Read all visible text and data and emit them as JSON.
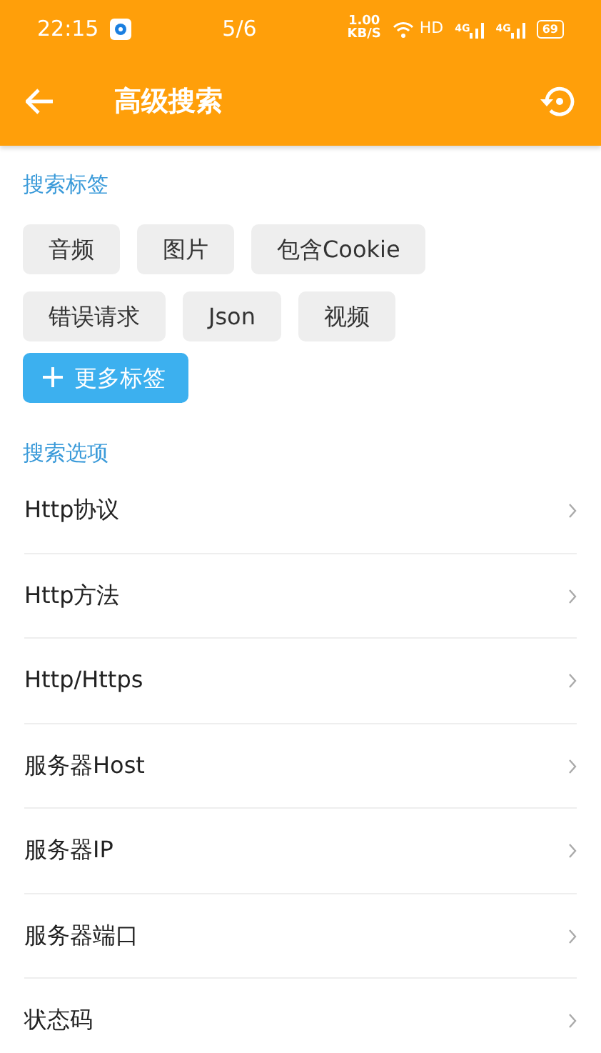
{
  "status_bar": {
    "time": "22:15",
    "page_counter": "5/6",
    "net_speed": "1.00",
    "net_unit": "KB/S",
    "hd": "HD",
    "signal_labels": [
      "4G",
      "4G"
    ],
    "battery": "69"
  },
  "app_bar": {
    "title": "高级搜索"
  },
  "tags_section": {
    "title": "搜索标签",
    "tags": [
      "音频",
      "图片",
      "包含Cookie",
      "错误请求",
      "Json",
      "视频"
    ],
    "more_button": "更多标签"
  },
  "options_section": {
    "title": "搜索选项",
    "items": [
      "Http协议",
      "Http方法",
      "Http/Https",
      "服务器Host",
      "服务器IP",
      "服务器端口",
      "状态码"
    ]
  }
}
